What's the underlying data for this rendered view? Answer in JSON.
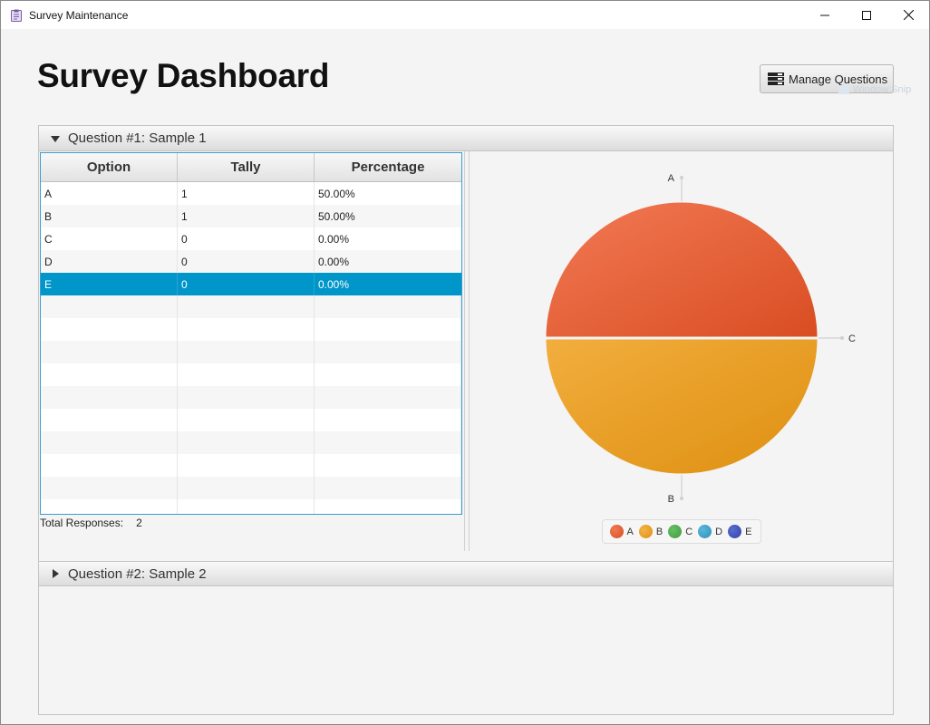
{
  "window": {
    "title": "Survey Maintenance",
    "minimize_icon": "minimize-icon",
    "maximize_icon": "maximize-icon",
    "close_icon": "close-icon"
  },
  "page": {
    "title": "Survey Dashboard",
    "manage_button_label": "Manage Questions",
    "ghost_text": "Window Snip"
  },
  "questions": [
    {
      "header": "Question #1: Sample 1",
      "expanded": true,
      "table": {
        "columns": [
          "Option",
          "Tally",
          "Percentage"
        ],
        "rows": [
          {
            "option": "A",
            "tally": "1",
            "percentage": "50.00%"
          },
          {
            "option": "B",
            "tally": "1",
            "percentage": "50.00%"
          },
          {
            "option": "C",
            "tally": "0",
            "percentage": "0.00%"
          },
          {
            "option": "D",
            "tally": "0",
            "percentage": "0.00%"
          },
          {
            "option": "E",
            "tally": "0",
            "percentage": "0.00%"
          }
        ],
        "selected_row": 4
      },
      "total_label": "Total Responses:",
      "total_value": "2"
    },
    {
      "header": "Question #2: Sample 2",
      "expanded": false
    }
  ],
  "chart_data": {
    "type": "pie",
    "categories": [
      "A",
      "B",
      "C",
      "D",
      "E"
    ],
    "values": [
      1,
      1,
      0,
      0,
      0
    ],
    "colors": [
      "#e05a2d",
      "#e8a020",
      "#4caa4c",
      "#3aa0c8",
      "#3b4fb8"
    ],
    "slice_labels": [
      "A",
      "B",
      "C"
    ],
    "legend": [
      "A",
      "B",
      "C",
      "D",
      "E"
    ],
    "legend_position": "bottom"
  }
}
